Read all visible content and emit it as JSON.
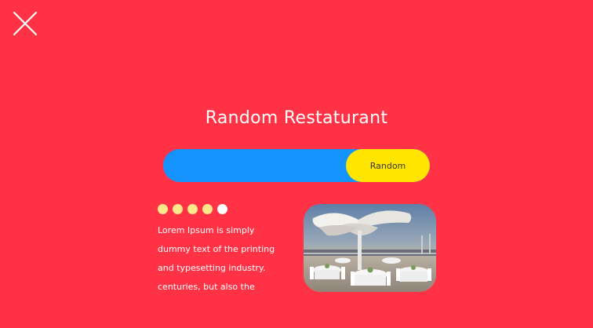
{
  "close": {
    "icon": "close-icon"
  },
  "title": "Random Restaturant",
  "search": {
    "value": "",
    "placeholder": ""
  },
  "random_button": {
    "label": "Random"
  },
  "rating": {
    "value": 4,
    "max": 5,
    "icon": "dot-rating-icon"
  },
  "description": {
    "lines": [
      "Lorem Ipsum is simply",
      "dummy text of the printing",
      "and typesetting industry.",
      "centuries, but also the"
    ]
  },
  "photo": {
    "icon": "restaurant-terrace-photo"
  },
  "colors": {
    "background": "#FF3345",
    "search_bar": "#1493FF",
    "button": "#FFE500",
    "star_filled": "#FFE98A",
    "star_empty": "#FFFFFF"
  }
}
